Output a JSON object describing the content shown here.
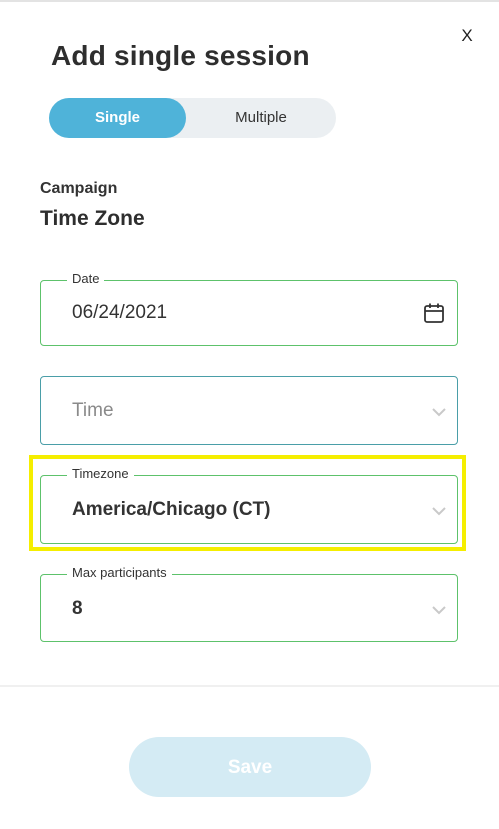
{
  "dialog": {
    "close_label": "X",
    "title": "Add single session"
  },
  "mode_toggle": {
    "options": [
      {
        "label": "Single",
        "selected": true
      },
      {
        "label": "Multiple",
        "selected": false
      }
    ]
  },
  "campaign": {
    "label": "Campaign",
    "value": "Time Zone"
  },
  "fields": {
    "date": {
      "legend": "Date",
      "value": "06/24/2021",
      "icon": "calendar-icon"
    },
    "time": {
      "placeholder": "Time",
      "icon": "chevron-down-icon"
    },
    "timezone": {
      "legend": "Timezone",
      "value": "America/Chicago (CT)",
      "icon": "chevron-down-icon"
    },
    "max_participants": {
      "legend": "Max participants",
      "value": "8",
      "icon": "chevron-down-icon"
    }
  },
  "footer": {
    "save_label": "Save",
    "save_enabled": false
  },
  "colors": {
    "accent": "#4fb3d9",
    "field_border": "#5dc26b",
    "time_border": "#4a9ea8",
    "highlight": "#f5ee00",
    "save_disabled": "#d4ebf4"
  }
}
